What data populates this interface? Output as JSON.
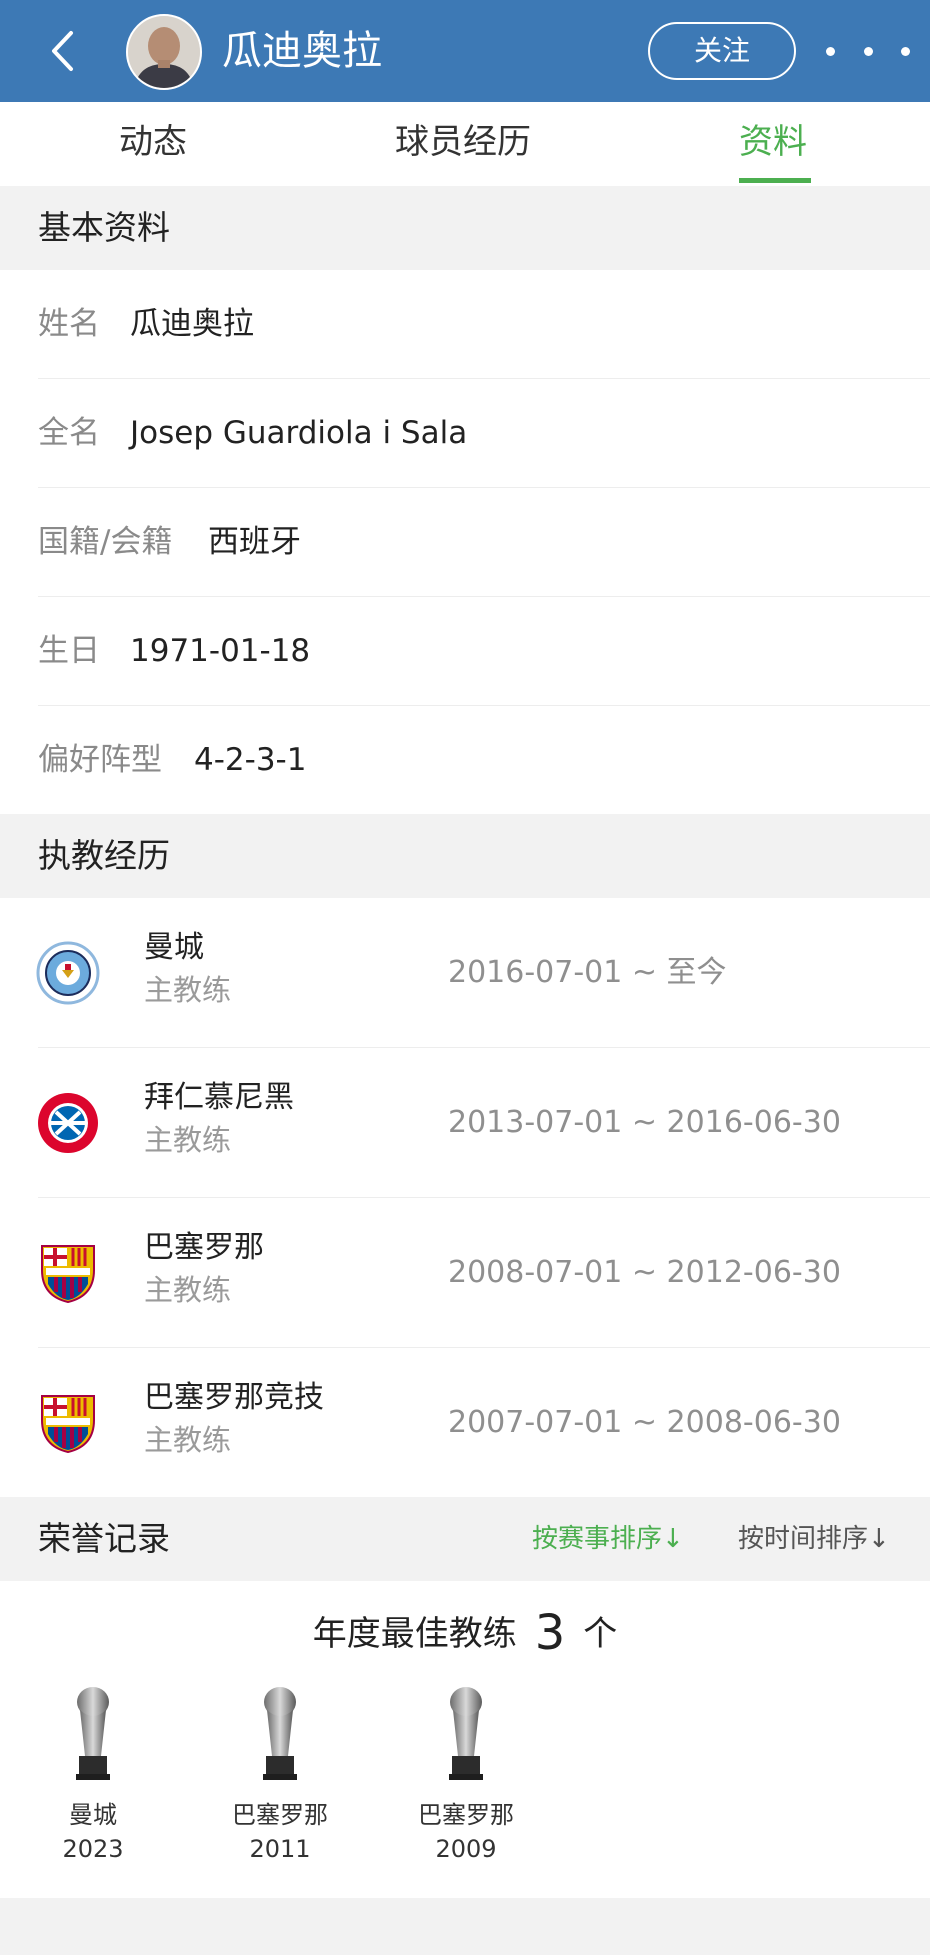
{
  "header": {
    "title": "瓜迪奥拉",
    "follow_label": "关注"
  },
  "tabs": [
    {
      "label": "动态"
    },
    {
      "label": "球员经历"
    },
    {
      "label": "资料",
      "active": true
    }
  ],
  "basic": {
    "section_label": "基本资料",
    "rows": [
      {
        "key": "姓名",
        "value": "瓜迪奥拉"
      },
      {
        "key": "全名",
        "value": "Josep Guardiola i Sala"
      },
      {
        "key": "国籍/会籍",
        "value": "西班牙"
      },
      {
        "key": "生日",
        "value": "1971-01-18"
      },
      {
        "key": "偏好阵型",
        "value": "4-2-3-1"
      }
    ]
  },
  "coaching": {
    "section_label": "执教经历",
    "rows": [
      {
        "club": "曼城",
        "role": "主教练",
        "dates": "2016-07-01 ~ 至今",
        "logo": "man-city-logo"
      },
      {
        "club": "拜仁慕尼黑",
        "role": "主教练",
        "dates": "2013-07-01 ~ 2016-06-30",
        "logo": "bayern-logo"
      },
      {
        "club": "巴塞罗那",
        "role": "主教练",
        "dates": "2008-07-01 ~ 2012-06-30",
        "logo": "barcelona-logo"
      },
      {
        "club": "巴塞罗那竞技",
        "role": "主教练",
        "dates": "2007-07-01 ~ 2008-06-30",
        "logo": "barcelona-logo"
      }
    ]
  },
  "honors": {
    "section_label": "荣誉记录",
    "sort_by_event": "按赛事排序↓",
    "sort_by_time": "按时间排序↓",
    "award_name": "年度最佳教练",
    "award_count": "3",
    "award_unit": "个",
    "trophies": [
      {
        "club": "曼城",
        "year": "2023"
      },
      {
        "club": "巴塞罗那",
        "year": "2011"
      },
      {
        "club": "巴塞罗那",
        "year": "2009"
      }
    ]
  },
  "colors": {
    "header_bg": "#3d79b5",
    "accent_green": "#4caf50",
    "section_bg": "#f2f2f2"
  }
}
